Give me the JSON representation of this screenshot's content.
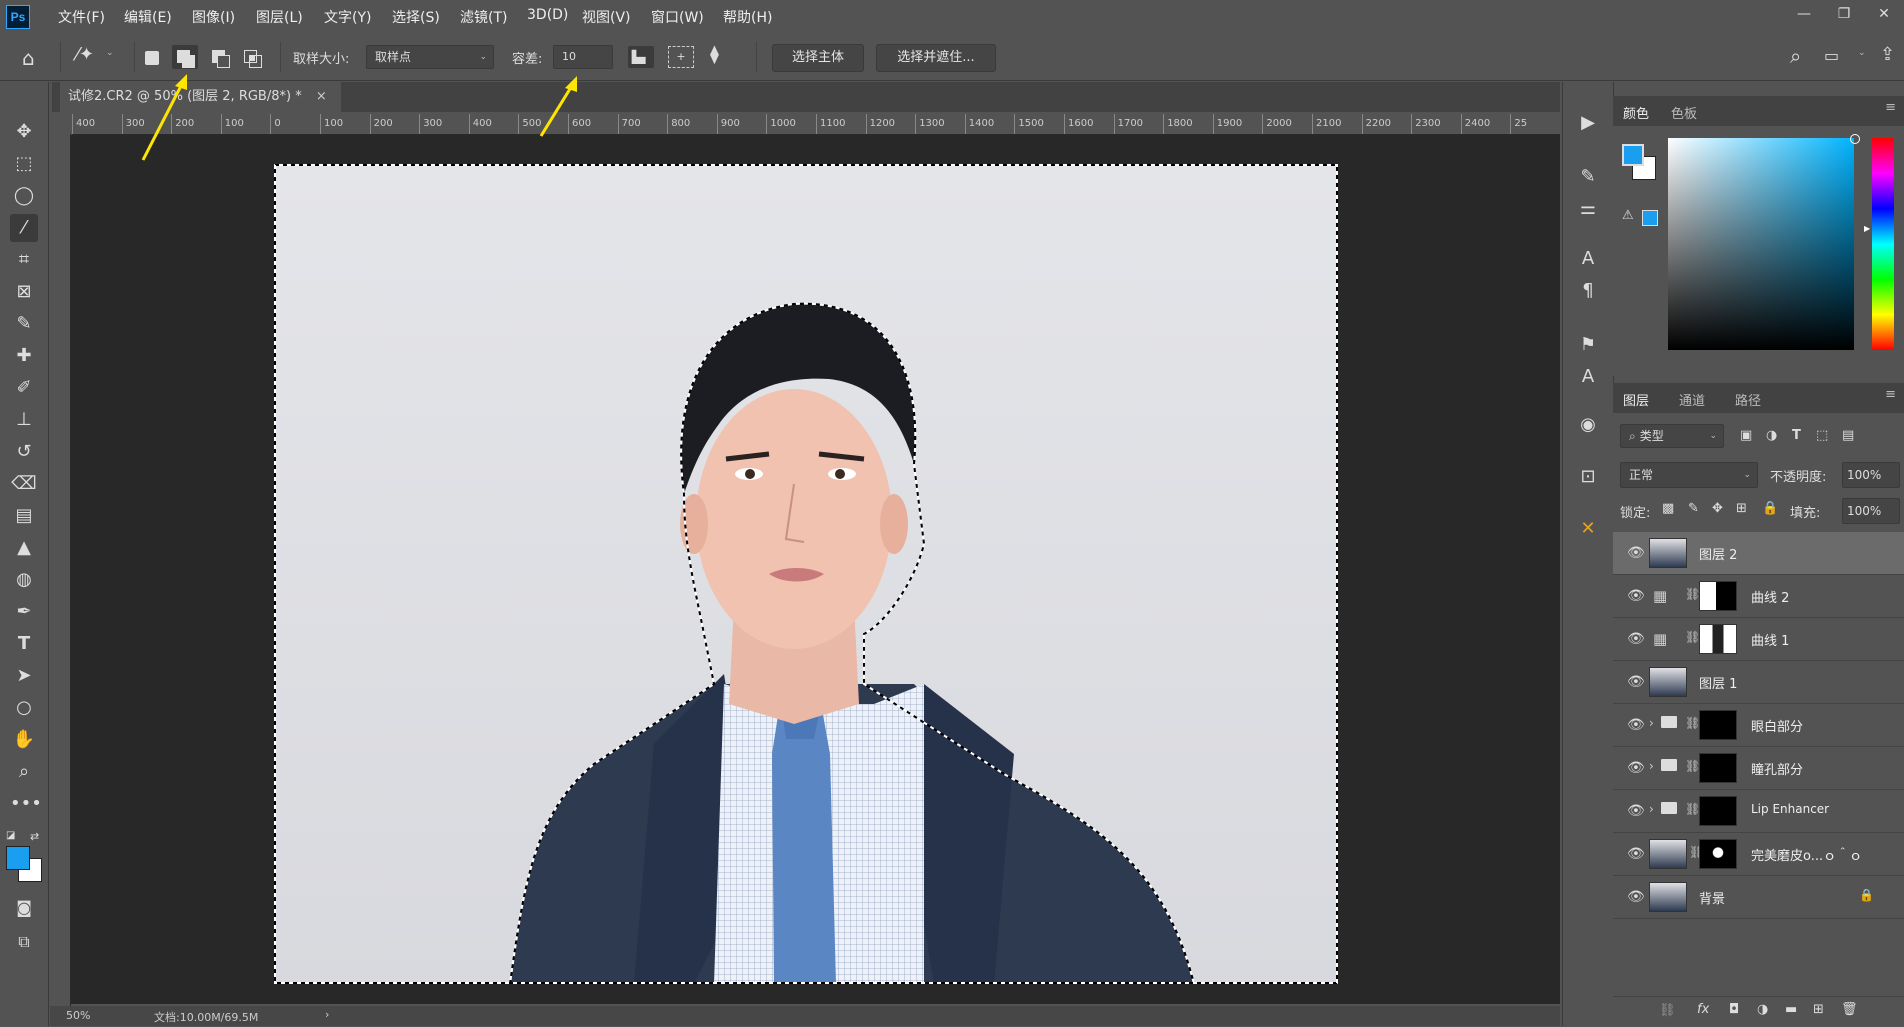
{
  "app": {
    "logo": "Ps",
    "menu": [
      "文件(F)",
      "编辑(E)",
      "图像(I)",
      "图层(L)",
      "文字(Y)",
      "选择(S)",
      "滤镜(T)",
      "3D(D)",
      "视图(V)",
      "窗口(W)",
      "帮助(H)"
    ]
  },
  "options": {
    "sample_size_label": "取样大小:",
    "sample_size_value": "取样点",
    "tolerance_label": "容差:",
    "tolerance_value": "10",
    "select_subject": "选择主体",
    "select_and_mask": "选择并遮住..."
  },
  "document": {
    "tab_title": "试修2.CR2 @ 50% (图层 2, RGB/8*) *",
    "close": "×"
  },
  "ruler": {
    "h_ticks": [
      "400",
      "300",
      "200",
      "100",
      "0",
      "100",
      "200",
      "300",
      "400",
      "500",
      "600",
      "700",
      "800",
      "900",
      "1000",
      "1100",
      "1200",
      "1300",
      "1400",
      "1500",
      "1600",
      "1700",
      "1800",
      "1900",
      "2000",
      "2100",
      "2200",
      "2300",
      "2400",
      "25"
    ]
  },
  "status": {
    "zoom": "50%",
    "doc_size": "文档:10.00M/69.5M",
    "arrow": "›"
  },
  "color_panel": {
    "tabs": [
      "颜色",
      "色板"
    ],
    "foreground": "#1a9ff0",
    "background": "#ffffff"
  },
  "layers_panel": {
    "tabs": [
      "图层",
      "通道",
      "路径"
    ],
    "filter": "类型",
    "blend_mode": "正常",
    "opacity_label": "不透明度:",
    "opacity_value": "100%",
    "lock_label": "锁定:",
    "fill_label": "填充:",
    "fill_value": "100%",
    "layers": [
      {
        "name": "图层 2",
        "kind": "pixel",
        "selected": true
      },
      {
        "name": "曲线 2",
        "kind": "adjustment"
      },
      {
        "name": "曲线 1",
        "kind": "adjustment"
      },
      {
        "name": "图层 1",
        "kind": "pixel"
      },
      {
        "name": "眼白部分",
        "kind": "group"
      },
      {
        "name": "瞳孔部分",
        "kind": "group"
      },
      {
        "name": "Lip Enhancer",
        "kind": "group"
      },
      {
        "name": "完美磨皮o...ｏ＾ｏ",
        "kind": "smart"
      },
      {
        "name": "背景",
        "kind": "background"
      }
    ],
    "bottom_fx": "fx"
  },
  "annotation_color": "#ffe600"
}
